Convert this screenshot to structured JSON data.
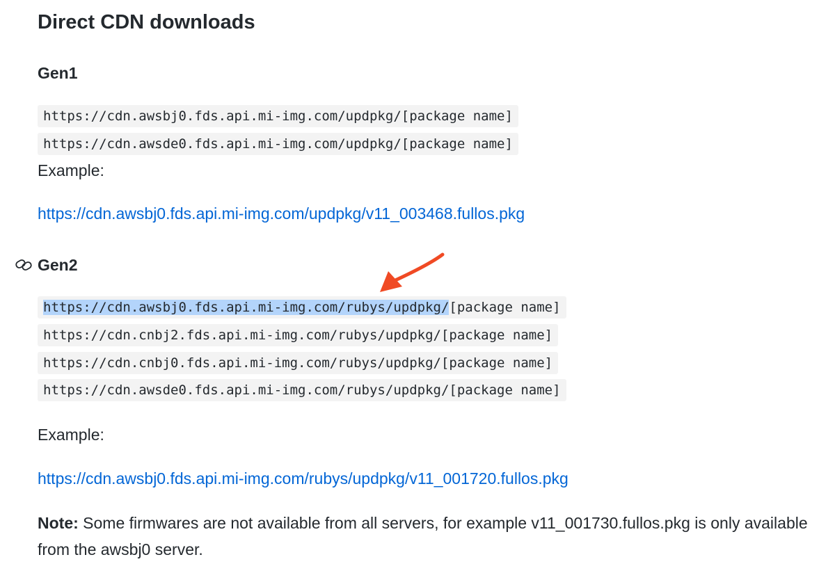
{
  "title": "Direct CDN downloads",
  "gen1": {
    "heading": "Gen1",
    "urls": [
      "https://cdn.awsbj0.fds.api.mi-img.com/updpkg/[package name]",
      "https://cdn.awsde0.fds.api.mi-img.com/updpkg/[package name]"
    ],
    "example_label": "Example:",
    "example_link": "https://cdn.awsbj0.fds.api.mi-img.com/updpkg/v11_003468.fullos.pkg"
  },
  "gen2": {
    "heading": "Gen2",
    "anchor_icon": "link-icon",
    "urls": [
      {
        "selected": "https://cdn.awsbj0.fds.api.mi-img.com/rubys/updpkg/",
        "rest": "[package name]"
      },
      "https://cdn.cnbj2.fds.api.mi-img.com/rubys/updpkg/[package name]",
      "https://cdn.cnbj0.fds.api.mi-img.com/rubys/updpkg/[package name]",
      "https://cdn.awsde0.fds.api.mi-img.com/rubys/updpkg/[package name]"
    ],
    "example_label": "Example:",
    "example_link": "https://cdn.awsbj0.fds.api.mi-img.com/rubys/updpkg/v11_001720.fullos.pkg"
  },
  "note": {
    "label": "Note:",
    "text": " Some firmwares are not available from all servers, for example v11_001730.fullos.pkg is only available from the awsbj0 server."
  },
  "colors": {
    "link": "#0366d6",
    "selection": "#b3d4fb",
    "arrow": "#f04a24",
    "code_bg": "#f3f3f3"
  },
  "annotation": {
    "icon": "red-arrow-icon"
  }
}
